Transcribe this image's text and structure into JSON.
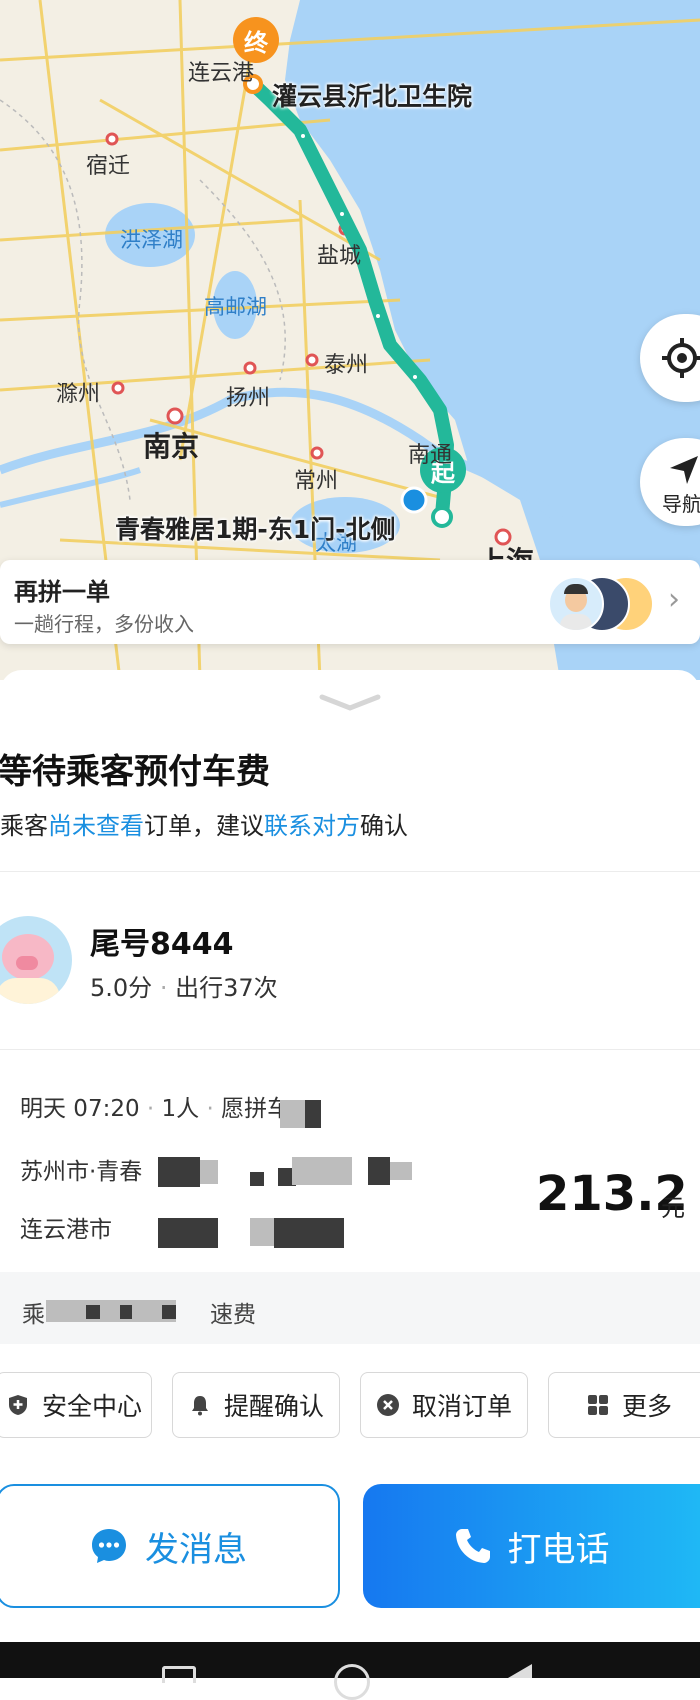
{
  "map": {
    "cities": {
      "lianyungang": "连云港",
      "suqian": "宿迁",
      "yancheng": "盐城",
      "taizhou": "泰州",
      "chuzhou": "滁州",
      "yangzhou": "扬州",
      "nanjing": "南京",
      "nantong": "南通",
      "changzhou": "常州",
      "shanghai": "上海"
    },
    "lakes": {
      "hongze": "洪泽湖",
      "gaoyou": "高邮湖",
      "taihu": "太湖"
    },
    "end_marker": "终",
    "start_marker": "起",
    "end_poi": "灌云县沂北卫生院",
    "start_poi": "青春雅居1期-东1门-北侧",
    "nav_label": "导航",
    "route_color": "#23b89a",
    "end_color": "#f7931e"
  },
  "again": {
    "title": "再拼一单",
    "subtitle": "一趟行程，多份收入"
  },
  "status": {
    "title": "等待乘客预付车费",
    "desc_1": "乘客",
    "desc_link_1": "尚未查看",
    "desc_2": "订单，建议",
    "desc_link_2": "联系对方",
    "desc_3": "确认",
    "link_color": "#1a8fe0"
  },
  "passenger": {
    "name": "尾号8444",
    "rating": "5.0分",
    "sep": "·",
    "trips": "出行37次"
  },
  "order": {
    "time": "明天 07:20",
    "count": "1人",
    "type": "愿拼车",
    "from_prefix": "苏州市·青春",
    "to_prefix": "连云港市",
    "price": "213.2",
    "unit": "元",
    "fee_start": "乘",
    "fee_end": "速费"
  },
  "actions": {
    "safety": "安全中心",
    "remind": "提醒确认",
    "cancel": "取消订单",
    "more": "更多"
  },
  "bottom": {
    "message": "发消息",
    "call": "打电话",
    "call_gradient_from": "#1678f0",
    "call_gradient_to": "#1fb8f5"
  }
}
